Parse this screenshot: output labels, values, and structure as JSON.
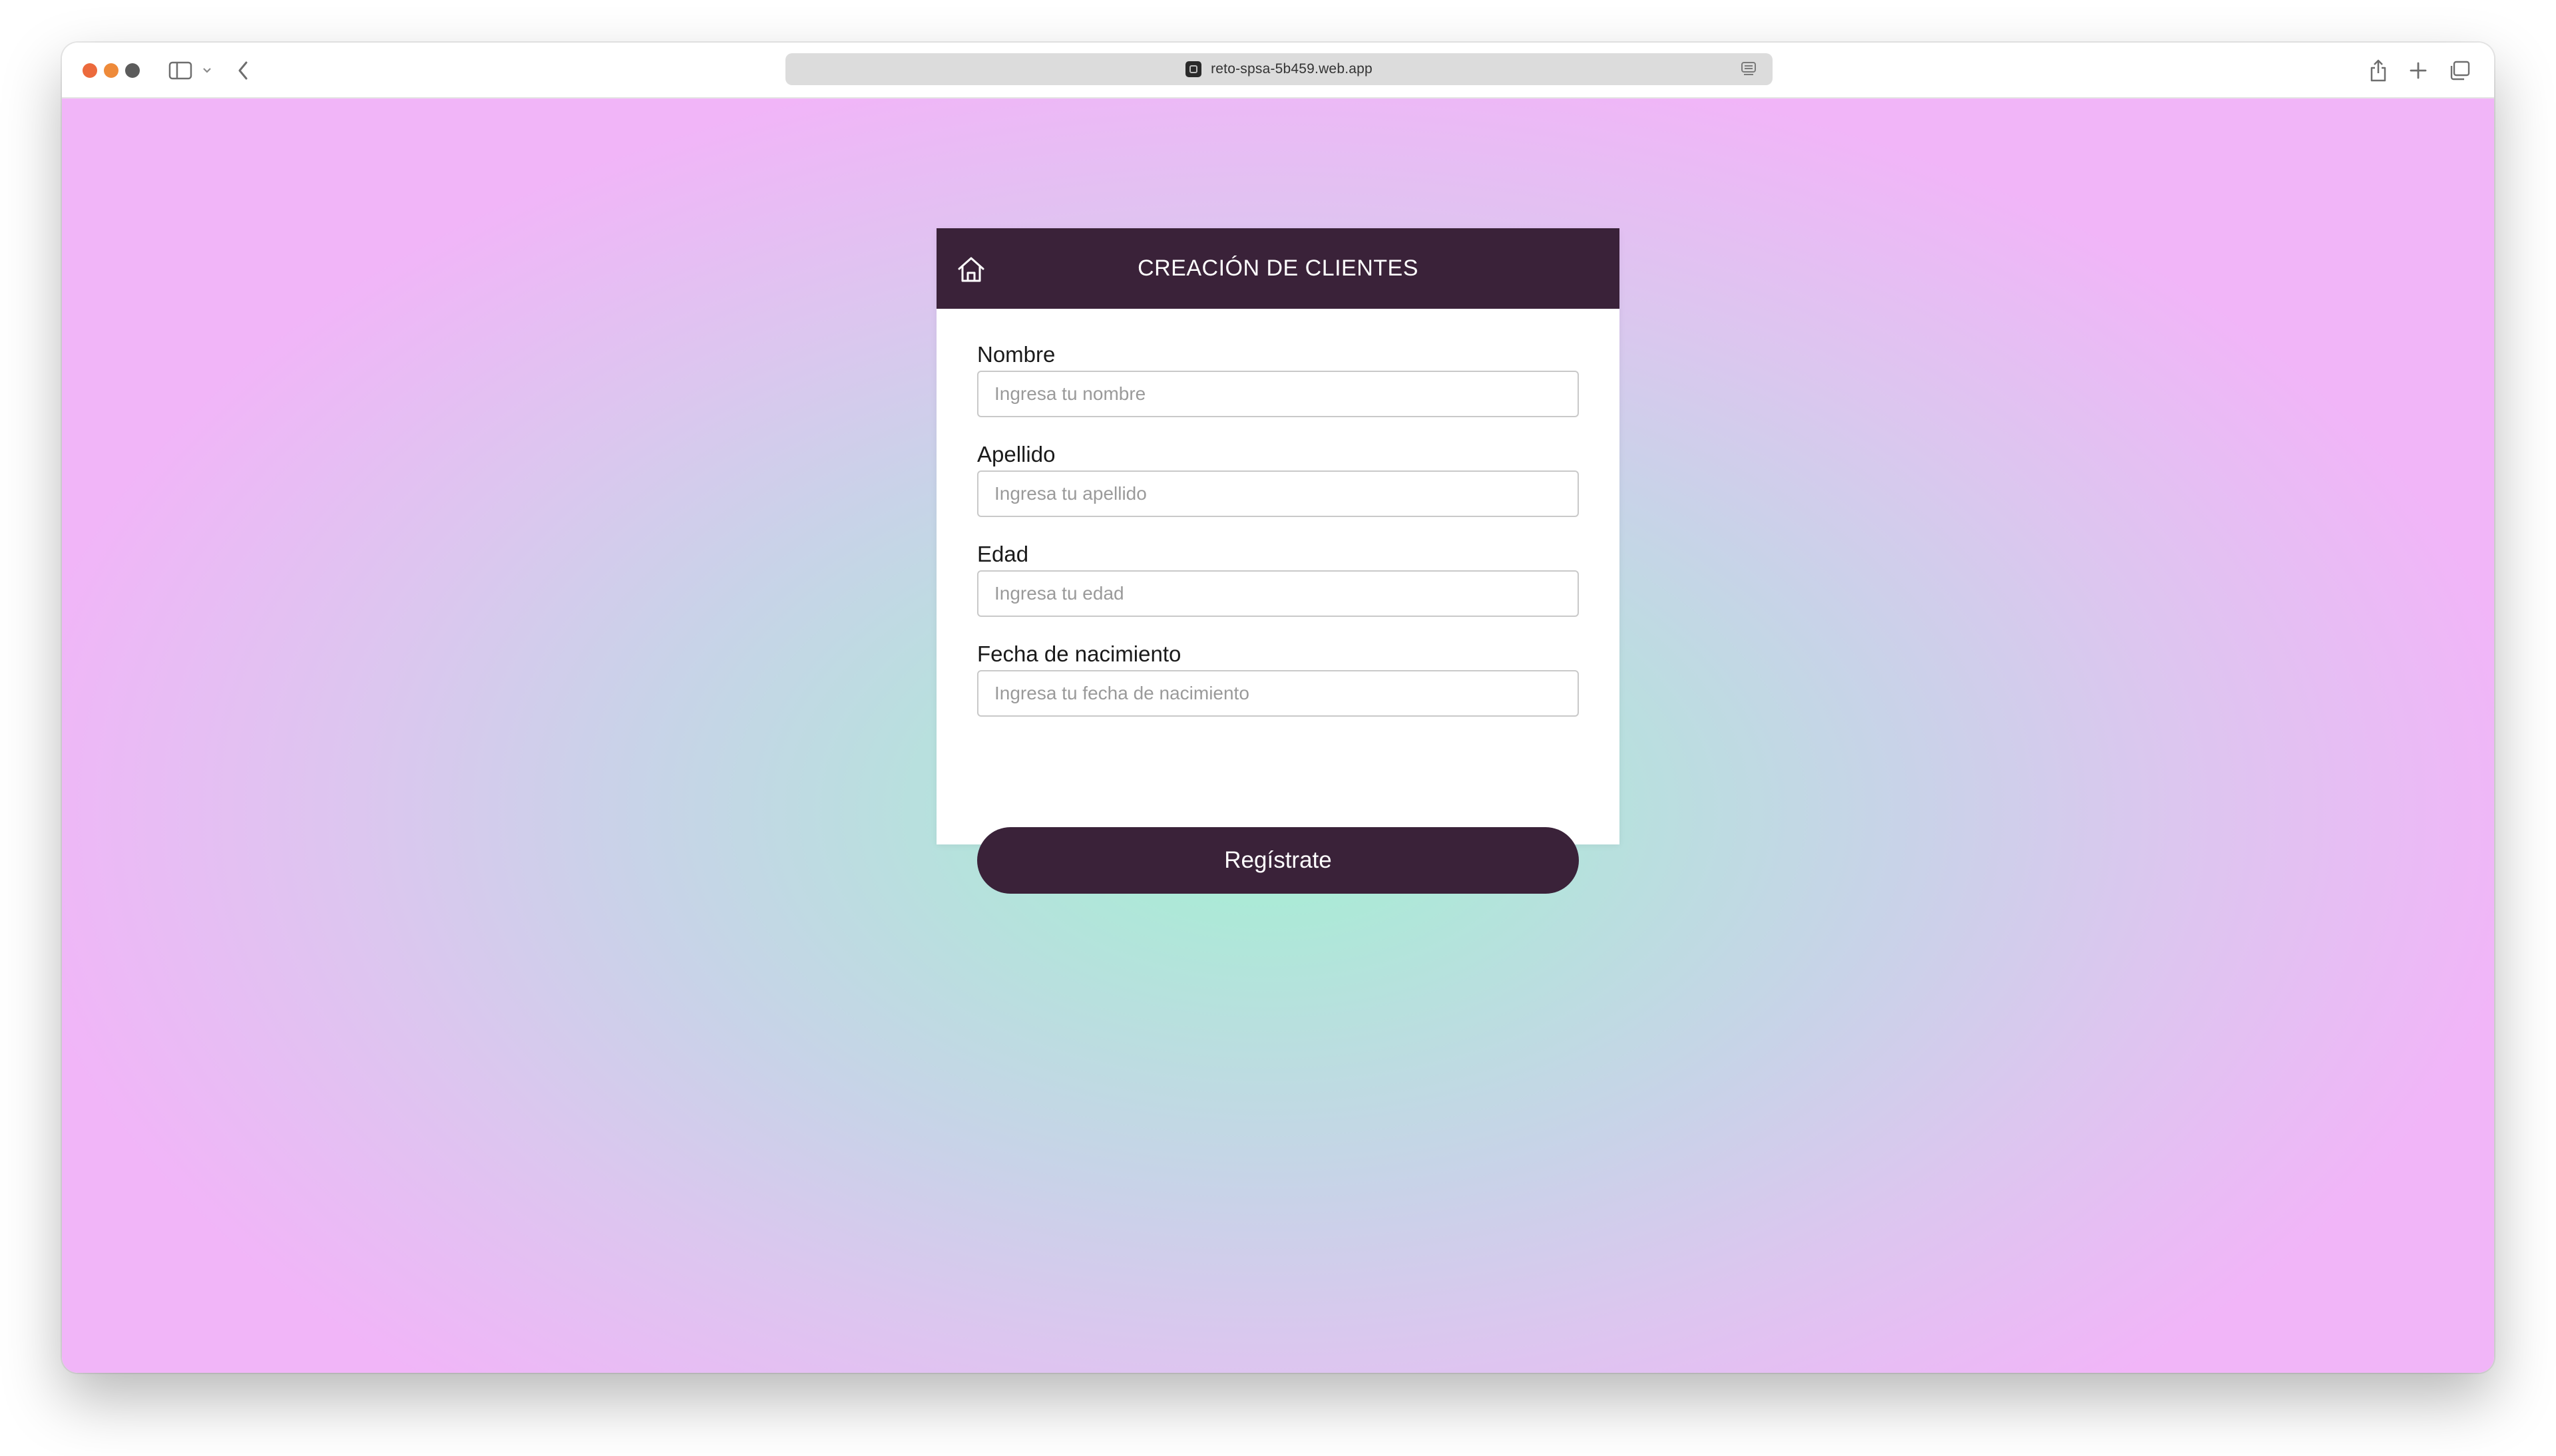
{
  "browser": {
    "url": "reto-spsa-5b459.web.app",
    "icons": {
      "sidebar": "sidebar-icon",
      "chevron": "chevron-down-icon",
      "back": "chevron-left-icon",
      "favicon": "favicon-icon",
      "reader": "reader-icon",
      "share": "share-icon",
      "new_tab": "plus-icon",
      "tabs": "tabs-overview-icon"
    },
    "traffic_colors": [
      "#ec6a3c",
      "#ee8a3a",
      "#5c5c5c"
    ]
  },
  "card": {
    "title": "CREACIÓN DE CLIENTES",
    "home_icon": "home-icon",
    "header_color": "#3a2239"
  },
  "form": {
    "fields": [
      {
        "label": "Nombre",
        "placeholder": "Ingresa tu nombre",
        "value": ""
      },
      {
        "label": "Apellido",
        "placeholder": "Ingresa tu apellido",
        "value": ""
      },
      {
        "label": "Edad",
        "placeholder": "Ingresa tu edad",
        "value": ""
      },
      {
        "label": "Fecha de nacimiento",
        "placeholder": "Ingresa tu fecha de nacimiento",
        "value": ""
      }
    ],
    "submit_label": "Regístrate"
  },
  "background": {
    "center_color": "#a3f1d2",
    "edge_color": "#f1b5f8"
  }
}
